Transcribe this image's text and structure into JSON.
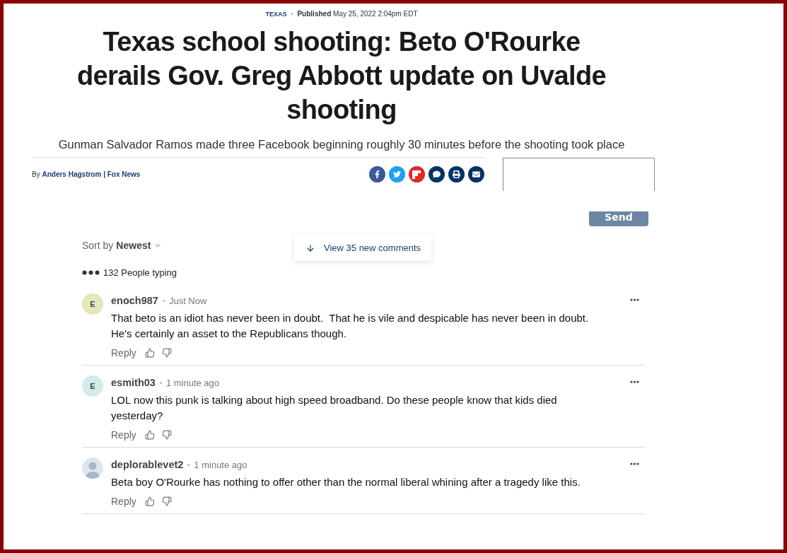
{
  "article": {
    "category": "TEXAS",
    "published_label": "Published",
    "published_date": "May 25, 2022 2:04pm EDT",
    "headline": "Texas school shooting: Beto O'Rourke derails Gov. Greg Abbott update on Uvalde shooting",
    "subheadline": "Gunman Salvador Ramos made three Facebook beginning roughly 30 minutes before the shooting took place",
    "byline_prefix": "By",
    "author": "Anders Hagstrom",
    "separator": "|",
    "outlet": "Fox News",
    "share_buttons": [
      {
        "kind": "facebook",
        "color": "#3b5998"
      },
      {
        "kind": "twitter",
        "color": "#1da1f2"
      },
      {
        "kind": "flipboard",
        "color": "#e12828"
      },
      {
        "kind": "comment",
        "color": "#003366"
      },
      {
        "kind": "print",
        "color": "#003366"
      },
      {
        "kind": "email",
        "color": "#003366"
      }
    ]
  },
  "comment_form": {
    "send_button": "Send"
  },
  "comments_section": {
    "sort_label": "Sort by",
    "sort_value": "Newest",
    "new_comments_button": "View 35 new comments",
    "typing_indicator": "132 People typing",
    "comments": [
      {
        "avatar": {
          "kind": "letter",
          "letter": "E",
          "color": "#e6e6bd"
        },
        "username": "enoch987",
        "time": "Just Now",
        "text": "That beto is an idiot has never been in doubt.  That he is vile and despicable has never been in doubt.   He's certainly an asset to the Republicans though.",
        "reply": "Reply"
      },
      {
        "avatar": {
          "kind": "letter",
          "letter": "E",
          "color": "#d3ebea"
        },
        "username": "esmith03",
        "time": "1 minute ago",
        "text": "LOL now this punk is talking about high speed broadband. Do these people know that kids died yesterday?",
        "reply": "Reply"
      },
      {
        "avatar": {
          "kind": "silhouette",
          "color": "#dde5ee"
        },
        "username": "deplorablevet2",
        "time": "1 minute ago",
        "text": "Beta boy O'Rourke has nothing to offer other than the normal liberal whining after a tragedy like this.",
        "reply": "Reply"
      }
    ]
  }
}
